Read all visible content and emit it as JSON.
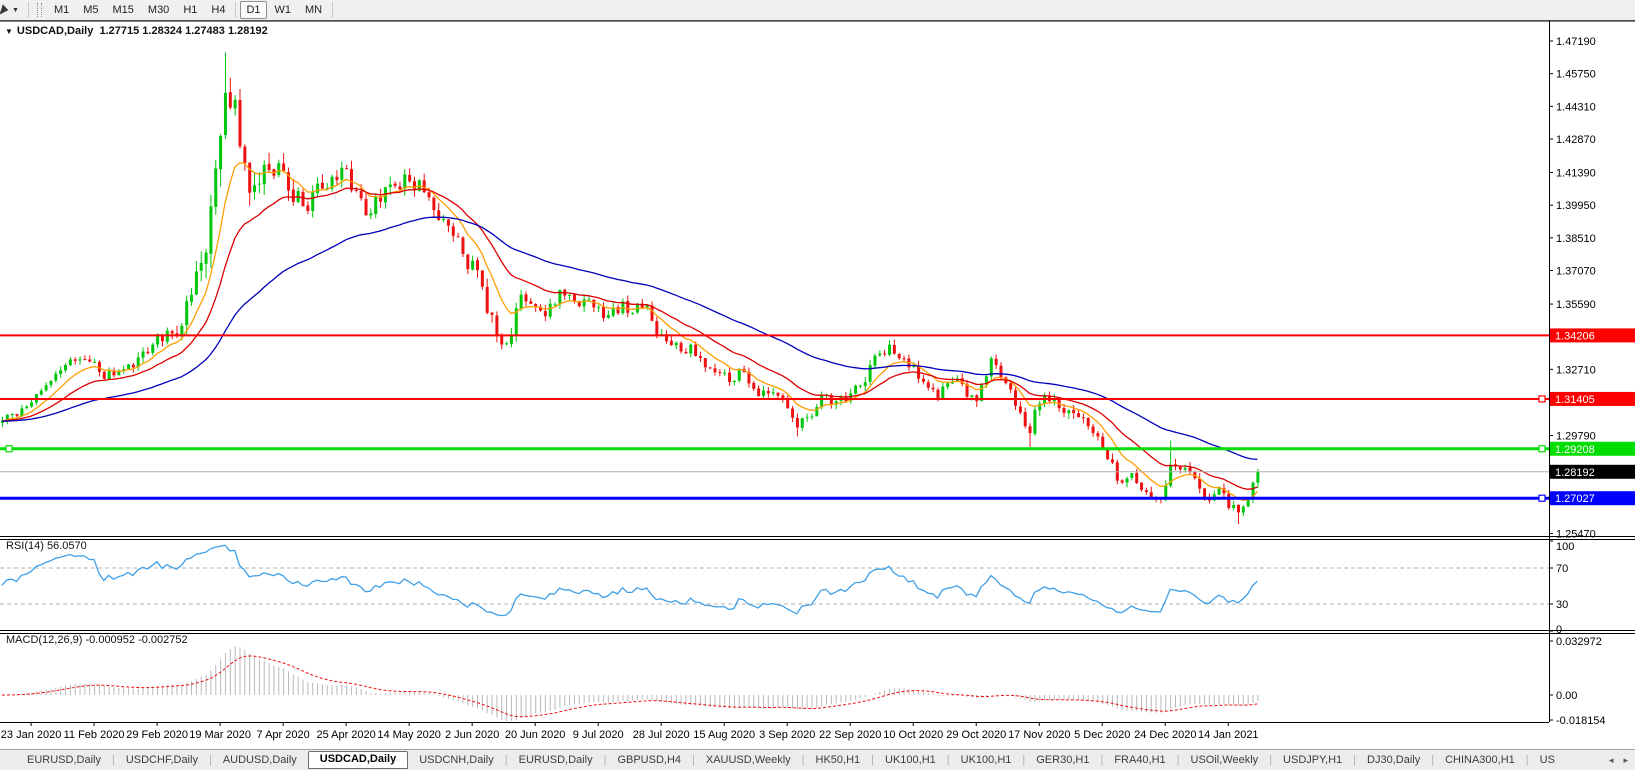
{
  "toolbar": {
    "timeframes": [
      "M1",
      "M5",
      "M15",
      "M30",
      "H1",
      "H4",
      "D1",
      "W1",
      "MN"
    ],
    "active_timeframe": "D1"
  },
  "title": {
    "symbol_label": "USDCAD,Daily",
    "open": "1.27715",
    "high": "1.28324",
    "low": "1.27483",
    "close": "1.28192"
  },
  "chart_data": {
    "type": "candlestick",
    "title": "USDCAD,Daily",
    "symbol": "USDCAD",
    "timeframe": "Daily",
    "quote": {
      "open": 1.27715,
      "high": 1.28324,
      "low": 1.27483,
      "close": 1.28192
    },
    "y_axis": {
      "side": "right",
      "ticks": [
        1.4719,
        1.4575,
        1.4431,
        1.4287,
        1.4139,
        1.3995,
        1.3851,
        1.3707,
        1.3559,
        1.3271,
        1.2979,
        1.2547
      ]
    },
    "x_axis": {
      "labels": [
        "23 Jan 2020",
        "11 Feb 2020",
        "29 Feb 2020",
        "19 Mar 2020",
        "7 Apr 2020",
        "25 Apr 2020",
        "14 May 2020",
        "2 Jun 2020",
        "20 Jun 2020",
        "9 Jul 2020",
        "28 Jul 2020",
        "15 Aug 2020",
        "3 Sep 2020",
        "22 Sep 2020",
        "10 Oct 2020",
        "29 Oct 2020",
        "17 Nov 2020",
        "5 Dec 2020",
        "24 Dec 2020",
        "14 Jan 2021"
      ],
      "first_label_bar": 6,
      "bars_per_label": 13
    },
    "bars_count": 260,
    "price_keyframes": [
      [
        0,
        1.3045
      ],
      [
        6,
        1.3125
      ],
      [
        10,
        1.322
      ],
      [
        13,
        1.329
      ],
      [
        17,
        1.3315
      ],
      [
        20,
        1.326
      ],
      [
        23,
        1.3245
      ],
      [
        27,
        1.328
      ],
      [
        31,
        1.338
      ],
      [
        33,
        1.3395
      ],
      [
        36,
        1.342
      ],
      [
        39,
        1.36
      ],
      [
        41,
        1.374
      ],
      [
        43,
        1.399
      ],
      [
        45,
        1.43
      ],
      [
        46,
        1.449
      ],
      [
        48,
        1.446
      ],
      [
        50,
        1.418
      ],
      [
        51,
        1.405
      ],
      [
        53,
        1.409
      ],
      [
        55,
        1.415
      ],
      [
        57,
        1.418
      ],
      [
        59,
        1.406
      ],
      [
        62,
        1.399
      ],
      [
        65,
        1.409
      ],
      [
        68,
        1.412
      ],
      [
        70,
        1.416
      ],
      [
        73,
        1.406
      ],
      [
        75,
        1.395
      ],
      [
        78,
        1.401
      ],
      [
        81,
        1.408
      ],
      [
        84,
        1.41
      ],
      [
        86,
        1.4105
      ],
      [
        88,
        1.403
      ],
      [
        90,
        1.393
      ],
      [
        93,
        1.386
      ],
      [
        95,
        1.378
      ],
      [
        97,
        1.375
      ],
      [
        100,
        1.352
      ],
      [
        102,
        1.342
      ],
      [
        103,
        1.338
      ],
      [
        105,
        1.342
      ],
      [
        107,
        1.36
      ],
      [
        109,
        1.356
      ],
      [
        111,
        1.353
      ],
      [
        113,
        1.356
      ],
      [
        115,
        1.362
      ],
      [
        118,
        1.357
      ],
      [
        120,
        1.358
      ],
      [
        123,
        1.3545
      ],
      [
        125,
        1.351
      ],
      [
        128,
        1.357
      ],
      [
        130,
        1.352
      ],
      [
        133,
        1.3555
      ],
      [
        135,
        1.342
      ],
      [
        137,
        1.3395
      ],
      [
        140,
        1.335
      ],
      [
        142,
        1.338
      ],
      [
        145,
        1.328
      ],
      [
        148,
        1.3255
      ],
      [
        150,
        1.3215
      ],
      [
        153,
        1.326
      ],
      [
        155,
        1.3185
      ],
      [
        158,
        1.3165
      ],
      [
        160,
        1.3155
      ],
      [
        162,
        1.31
      ],
      [
        164,
        1.3015
      ],
      [
        166,
        1.306
      ],
      [
        168,
        1.3105
      ],
      [
        170,
        1.316
      ],
      [
        172,
        1.313
      ],
      [
        175,
        1.3165
      ],
      [
        177,
        1.32
      ],
      [
        179,
        1.329
      ],
      [
        181,
        1.334
      ],
      [
        183,
        1.338
      ],
      [
        185,
        1.332
      ],
      [
        187,
        1.328
      ],
      [
        189,
        1.323
      ],
      [
        191,
        1.319
      ],
      [
        193,
        1.314
      ],
      [
        195,
        1.321
      ],
      [
        197,
        1.323
      ],
      [
        199,
        1.315
      ],
      [
        201,
        1.313
      ],
      [
        203,
        1.324
      ],
      [
        204,
        1.332
      ],
      [
        205,
        1.329
      ],
      [
        207,
        1.321
      ],
      [
        209,
        1.311
      ],
      [
        211,
        1.302
      ],
      [
        212,
        1.299
      ],
      [
        214,
        1.312
      ],
      [
        216,
        1.313
      ],
      [
        218,
        1.31
      ],
      [
        220,
        1.309
      ],
      [
        222,
        1.306
      ],
      [
        224,
        1.302
      ],
      [
        225,
        1.299
      ],
      [
        227,
        1.292
      ],
      [
        229,
        1.286
      ],
      [
        230,
        1.278
      ],
      [
        232,
        1.279
      ],
      [
        234,
        1.277
      ],
      [
        236,
        1.273
      ],
      [
        238,
        1.2705
      ],
      [
        240,
        1.276
      ],
      [
        241,
        1.285
      ],
      [
        243,
        1.283
      ],
      [
        245,
        1.282
      ],
      [
        247,
        1.2745
      ],
      [
        248,
        1.27
      ],
      [
        250,
        1.272
      ],
      [
        251,
        1.2745
      ],
      [
        253,
        1.266
      ],
      [
        255,
        1.264
      ],
      [
        256,
        1.2665
      ],
      [
        257,
        1.27
      ],
      [
        258,
        1.27715
      ],
      [
        259,
        1.28192
      ]
    ],
    "volatility_keyframes": [
      [
        0,
        0.005
      ],
      [
        30,
        0.006
      ],
      [
        40,
        0.014
      ],
      [
        46,
        0.022
      ],
      [
        55,
        0.013
      ],
      [
        70,
        0.01
      ],
      [
        90,
        0.009
      ],
      [
        100,
        0.01
      ],
      [
        110,
        0.008
      ],
      [
        140,
        0.006
      ],
      [
        170,
        0.006
      ],
      [
        200,
        0.007
      ],
      [
        230,
        0.007
      ],
      [
        259,
        0.006
      ]
    ],
    "extreme_wicks": [
      {
        "bar": 46,
        "high": 1.4668
      },
      {
        "bar": 164,
        "low": 1.2975
      },
      {
        "bar": 212,
        "low": 1.2928
      },
      {
        "bar": 238,
        "low": 1.2685
      },
      {
        "bar": 241,
        "high": 1.2957
      },
      {
        "bar": 255,
        "low": 1.2589
      }
    ],
    "horizontal_levels": [
      {
        "value": 1.34206,
        "label": "1.34206",
        "color": "#ff0000",
        "width": 2,
        "handle_left": false,
        "handle_right": false
      },
      {
        "value": 1.31405,
        "label": "1.31405",
        "color": "#ff0000",
        "width": 2,
        "handle_left": false,
        "handle_right": true
      },
      {
        "value": 1.29208,
        "label": "1.29208",
        "color": "#00dd00",
        "width": 3,
        "handle_left": true,
        "handle_right": true
      },
      {
        "value": 1.27027,
        "label": "1.27027",
        "color": "#0000ff",
        "width": 3,
        "handle_left": false,
        "handle_right": true
      }
    ],
    "current_price": {
      "value": 1.28192,
      "label": "1.28192",
      "line_color": "#b0b0b0",
      "tag_bg": "#000000"
    },
    "candle_colors": {
      "up": "#00c60c",
      "down": "#ee1111"
    },
    "moving_averages": [
      {
        "name": "ma-fast",
        "color": "#ff9d00"
      },
      {
        "name": "ma-mid",
        "color": "#dd0000"
      },
      {
        "name": "ma-slow",
        "color": "#0000bb"
      }
    ],
    "indicators": {
      "rsi": {
        "label": "RSI(14)",
        "value": "56.0570",
        "color": "#3e9fe8",
        "axis_labels": [
          "100",
          "70",
          "30",
          "0"
        ],
        "axis_values": [
          100,
          70,
          30,
          0
        ],
        "level_lines": [
          70,
          30
        ]
      },
      "macd": {
        "label": "MACD(12,26,9)",
        "value_main": "-0.000952",
        "value_signal": "-0.002752",
        "axis_labels": [
          "0.032972",
          "0.00",
          "-0.018154"
        ],
        "axis_values": [
          0.032972,
          0,
          -0.018154
        ],
        "histogram_color": "#b9b9b9",
        "signal_color": "#ee1111"
      }
    }
  },
  "bottom_tabs": {
    "active_index": 3,
    "labels": [
      "EURUSD,Daily",
      "USDCHF,Daily",
      "AUDUSD,Daily",
      "USDCAD,Daily",
      "USDCNH,Daily",
      "EURUSD,Daily",
      "GBPUSD,H4",
      "XAUUSD,Weekly",
      "HK50,H1",
      "UK100,H1",
      "UK100,H1",
      "GER30,H1",
      "FRA40,H1",
      "USOil,Weekly",
      "USDJPY,H1",
      "DJ30,Daily",
      "CHINA300,H1",
      "US"
    ],
    "scroll_left": "◂",
    "scroll_right": "▸"
  }
}
